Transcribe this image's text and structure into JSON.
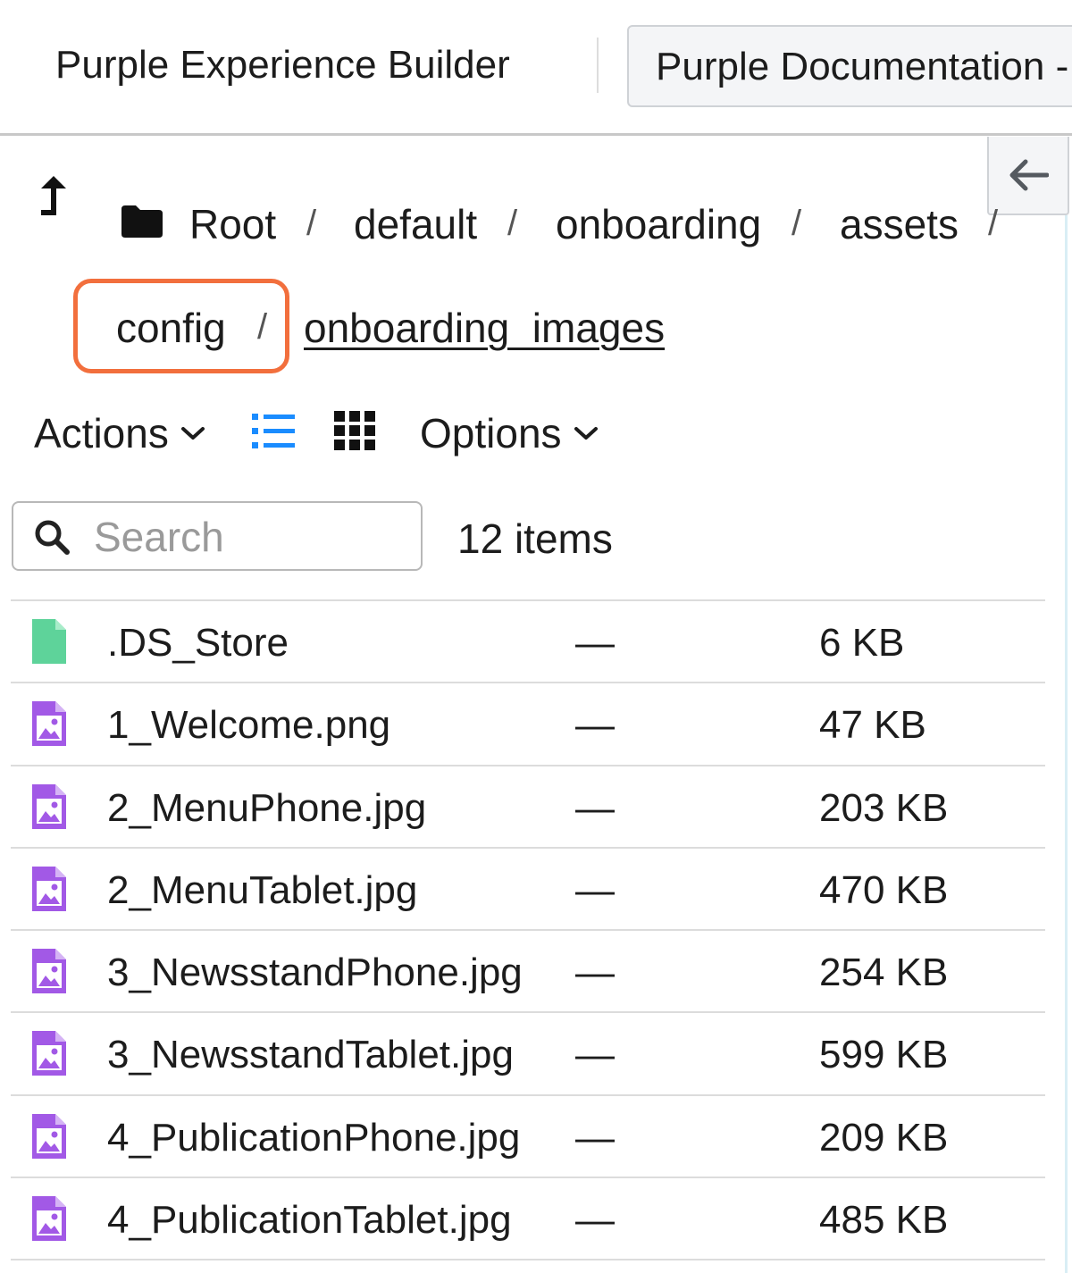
{
  "tabs": [
    {
      "label": "Purple Experience Builder"
    },
    {
      "label": "Purple Documentation - A"
    }
  ],
  "breadcrumb": {
    "items": [
      "Root",
      "default",
      "onboarding",
      "assets",
      "config"
    ],
    "separator": "/",
    "current": "onboarding_images"
  },
  "toolbar": {
    "actions_label": "Actions",
    "options_label": "Options"
  },
  "search": {
    "placeholder": "Search",
    "value": ""
  },
  "item_count": "12 items",
  "files": [
    {
      "name": ".DS_Store",
      "modified": "—",
      "size": "6 KB",
      "icon": "file-icon"
    },
    {
      "name": "1_Welcome.png",
      "modified": "—",
      "size": "47 KB",
      "icon": "image-file-icon"
    },
    {
      "name": "2_MenuPhone.jpg",
      "modified": "—",
      "size": "203 KB",
      "icon": "image-file-icon"
    },
    {
      "name": "2_MenuTablet.jpg",
      "modified": "—",
      "size": "470 KB",
      "icon": "image-file-icon"
    },
    {
      "name": "3_NewsstandPhone.jpg",
      "modified": "—",
      "size": "254 KB",
      "icon": "image-file-icon"
    },
    {
      "name": "3_NewsstandTablet.jpg",
      "modified": "—",
      "size": "599 KB",
      "icon": "image-file-icon"
    },
    {
      "name": "4_PublicationPhone.jpg",
      "modified": "—",
      "size": "209 KB",
      "icon": "image-file-icon"
    },
    {
      "name": "4_PublicationTablet.jpg",
      "modified": "—",
      "size": "485 KB",
      "icon": "image-file-icon"
    }
  ],
  "colors": {
    "highlight": "#f26f3d",
    "active_view": "#1a8cff",
    "generic_file": "#5ed39a",
    "image_file": "#a259e6"
  }
}
